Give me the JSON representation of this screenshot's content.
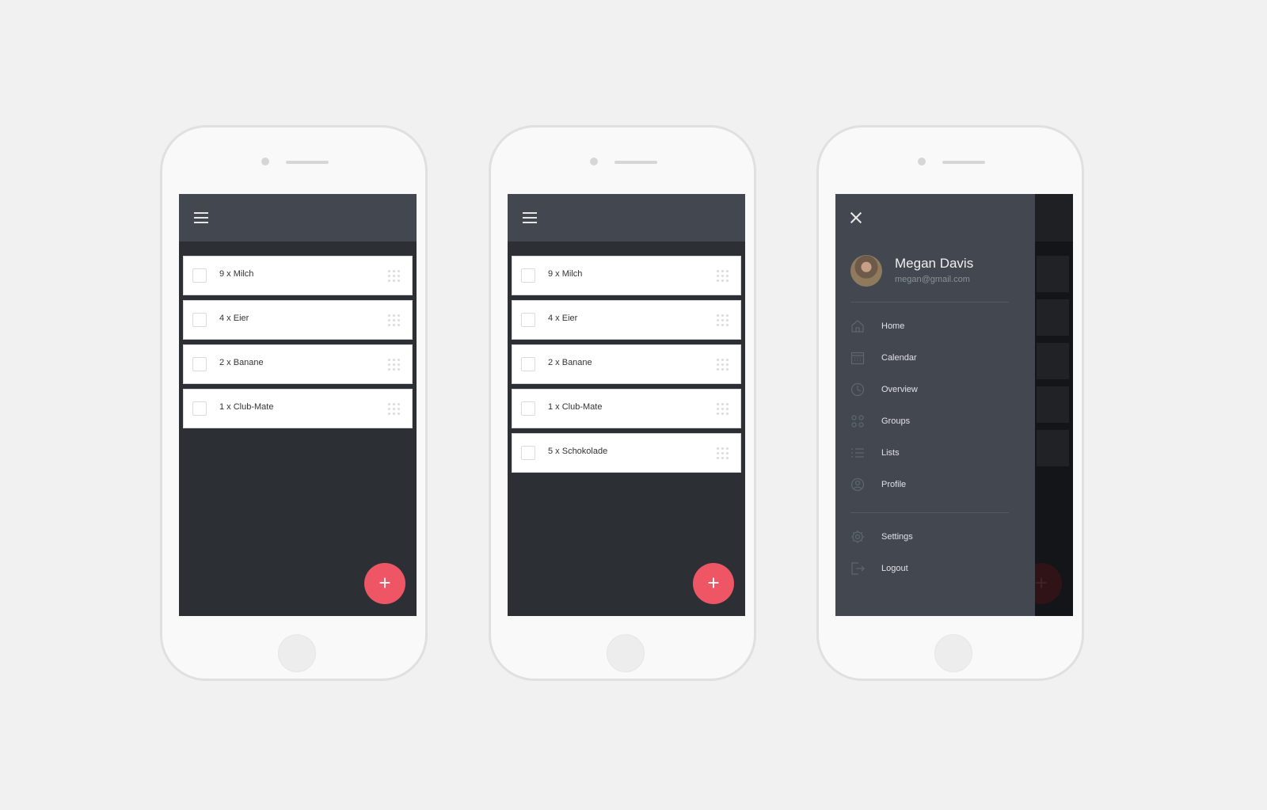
{
  "colors": {
    "background": "#f1f1f1",
    "header": "#434850",
    "screen": "#2c3035",
    "fab": "#ee5665"
  },
  "phone1": {
    "items": [
      "9 x Milch",
      "4 x Eier",
      "2 x Banane",
      "1 x Club-Mate"
    ],
    "fab_label": "+"
  },
  "phone2": {
    "items": [
      "9 x Milch",
      "4 x Eier",
      "2 x Banane",
      "1 x Club-Mate",
      "5 x Schokolade"
    ],
    "fab_label": "+"
  },
  "phone3": {
    "user": {
      "name": "Megan Davis",
      "email": "megan@gmail.com"
    },
    "nav": [
      {
        "label": "Home",
        "icon": "home-icon"
      },
      {
        "label": "Calendar",
        "icon": "calendar-icon"
      },
      {
        "label": "Overview",
        "icon": "clock-icon"
      },
      {
        "label": "Groups",
        "icon": "groups-icon"
      },
      {
        "label": "Lists",
        "icon": "list-icon"
      },
      {
        "label": "Profile",
        "icon": "profile-icon"
      }
    ],
    "secondary_nav": [
      {
        "label": "Settings",
        "icon": "gear-icon"
      },
      {
        "label": "Logout",
        "icon": "logout-icon"
      }
    ],
    "fab_label": "+"
  }
}
